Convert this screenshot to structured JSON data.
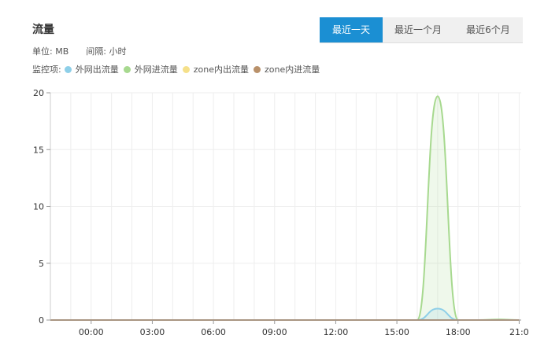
{
  "header": {
    "title": "流量"
  },
  "tabs": [
    {
      "label": "最近一天",
      "active": true
    },
    {
      "label": "最近一个月",
      "active": false
    },
    {
      "label": "最近6个月",
      "active": false
    }
  ],
  "meta": {
    "unit": "单位: MB",
    "interval": "间隔: 小时"
  },
  "legend": {
    "label": "监控项:",
    "items": [
      {
        "name": "外网出流量",
        "color": "#8ecfe8"
      },
      {
        "name": "外网进流量",
        "color": "#a7d98f"
      },
      {
        "name": "zone内出流量",
        "color": "#f5e08a"
      },
      {
        "name": "zone内进流量",
        "color": "#b9916a"
      }
    ]
  },
  "chart_data": {
    "type": "area",
    "x_tick_labels": [
      "00:00",
      "03:00",
      "06:00",
      "09:00",
      "12:00",
      "15:00",
      "18:00",
      "21:0"
    ],
    "y_tick_labels": [
      "0",
      "5",
      "10",
      "15",
      "20"
    ],
    "ylim": [
      0,
      20
    ],
    "x": [
      "-2",
      "-1",
      "0",
      "1",
      "2",
      "3",
      "4",
      "5",
      "6",
      "7",
      "8",
      "9",
      "10",
      "11",
      "12",
      "13",
      "14",
      "15",
      "16",
      "17",
      "18",
      "19",
      "20",
      "21"
    ],
    "series": [
      {
        "name": "外网出流量",
        "color": "#8ecfe8",
        "values": [
          0,
          0,
          0,
          0,
          0,
          0,
          0,
          0,
          0,
          0,
          0,
          0,
          0,
          0,
          0,
          0,
          0,
          0,
          0,
          1.0,
          0,
          0,
          0,
          0
        ]
      },
      {
        "name": "外网进流量",
        "color": "#a7d98f",
        "values": [
          0,
          0,
          0,
          0,
          0,
          0,
          0,
          0,
          0,
          0,
          0,
          0,
          0,
          0,
          0,
          0,
          0,
          0,
          0,
          19.7,
          0,
          0,
          0.05,
          0
        ]
      },
      {
        "name": "zone内出流量",
        "color": "#f5e08a",
        "values": [
          0,
          0,
          0,
          0,
          0,
          0,
          0,
          0,
          0,
          0,
          0,
          0,
          0,
          0,
          0,
          0,
          0,
          0,
          0,
          0,
          0,
          0,
          0,
          0
        ]
      },
      {
        "name": "zone内进流量",
        "color": "#b9916a",
        "values": [
          0,
          0,
          0,
          0,
          0,
          0,
          0,
          0,
          0,
          0,
          0,
          0,
          0,
          0,
          0,
          0,
          0,
          0,
          0,
          0,
          0,
          0,
          0,
          0
        ]
      }
    ],
    "grid": true
  }
}
